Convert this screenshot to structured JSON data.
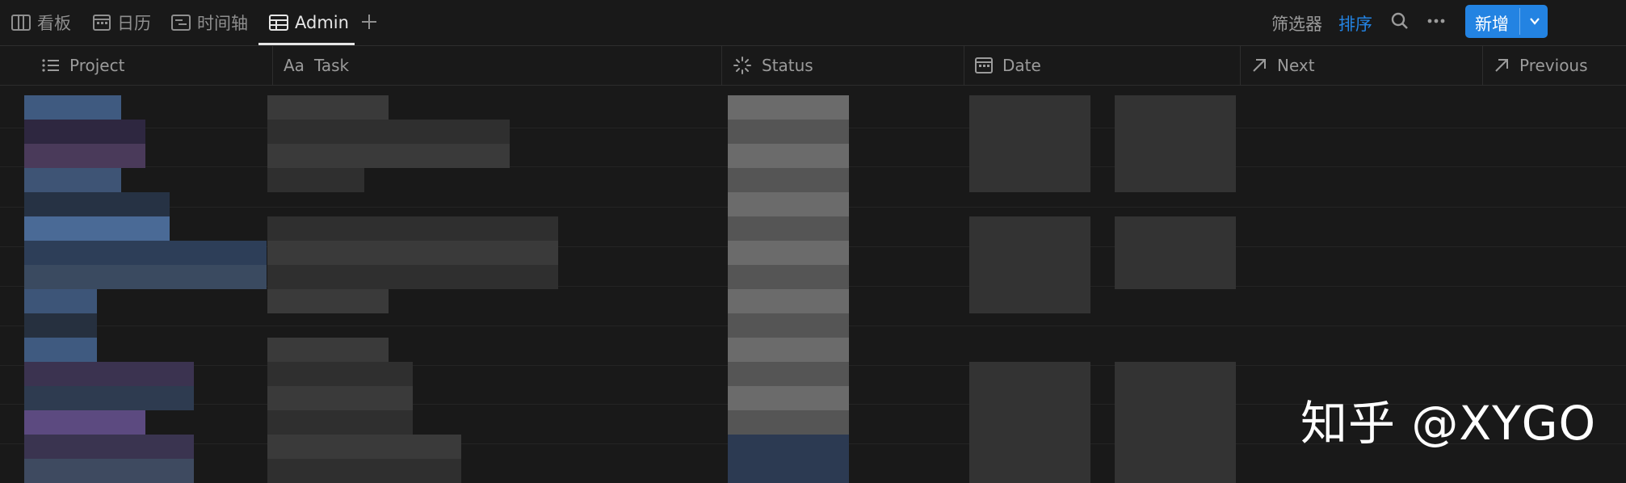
{
  "tabs": [
    {
      "label": "看板",
      "icon": "board-icon"
    },
    {
      "label": "日历",
      "icon": "calendar-icon"
    },
    {
      "label": "时间轴",
      "icon": "timeline-icon"
    },
    {
      "label": "Admin",
      "icon": "table-icon",
      "active": true
    }
  ],
  "toolbar": {
    "filter_label": "筛选器",
    "sort_label": "排序",
    "new_label": "新增",
    "accent": "#2383e2"
  },
  "columns": [
    {
      "label": "Project",
      "icon": "list-icon"
    },
    {
      "label": "Task",
      "icon": "text-icon",
      "icon_text": "Aa"
    },
    {
      "label": "Status",
      "icon": "status-icon"
    },
    {
      "label": "Date",
      "icon": "calendar-icon"
    },
    {
      "label": "Next",
      "icon": "arrow-up-right-icon"
    },
    {
      "label": "Previous",
      "icon": "arrow-up-right-icon"
    }
  ],
  "watermark": "知乎 @XYGO"
}
